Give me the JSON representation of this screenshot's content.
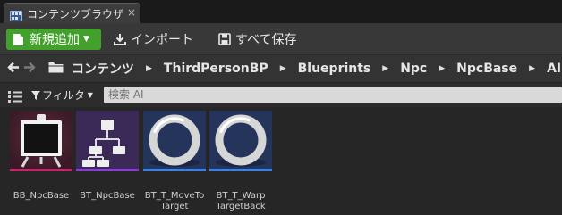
{
  "tab": {
    "title": "コンテンツブラウザ",
    "close": "×"
  },
  "toolbar": {
    "add_new_label": "新規追加",
    "import_label": "インポート",
    "save_all_label": "すべて保存"
  },
  "breadcrumb": [
    "コンテンツ",
    "ThirdPersonBP",
    "Blueprints",
    "Npc",
    "NpcBase",
    "AI"
  ],
  "filter": {
    "label": "フィルタ",
    "search_placeholder": "検索 AI"
  },
  "assets": [
    {
      "name": "BB_NpcBase",
      "icon": "blackboard-easel-icon",
      "type_color": "#c8216a",
      "bg": "#4a2232"
    },
    {
      "name": "BT_NpcBase",
      "icon": "behavior-tree-icon",
      "type_color": "#8a3cd6",
      "bg": "#3e2c5c"
    },
    {
      "name": "BT_T_MoveTo Target",
      "icon": "task-ring-icon",
      "type_color": "#3b82e8",
      "bg": "#26375a"
    },
    {
      "name": "BT_T_Warp TargetBack",
      "icon": "task-ring-icon",
      "type_color": "#3b82e8",
      "bg": "#26375a"
    }
  ]
}
